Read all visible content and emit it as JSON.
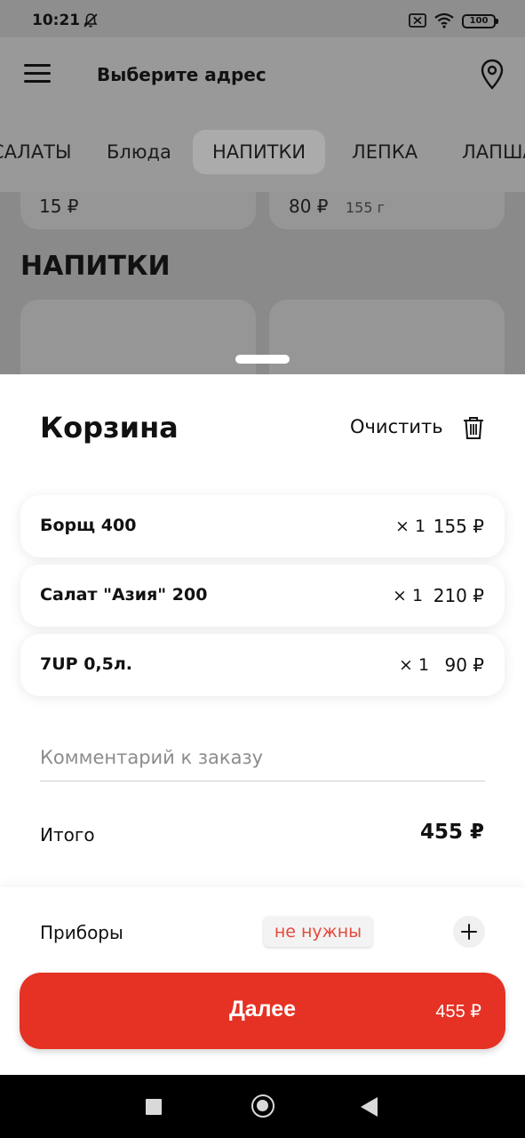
{
  "status_bar": {
    "time": "10:21",
    "battery": "100",
    "icons": [
      "dnd-off-icon",
      "sim-icon",
      "wifi-icon",
      "battery-icon"
    ]
  },
  "header": {
    "title": "Выберите адрес",
    "menu_icon": "hamburger-menu-icon",
    "location_icon": "map-pin-icon"
  },
  "tabs": [
    {
      "label": "САЛАТЫ",
      "active": false
    },
    {
      "label": "Блюда",
      "active": false
    },
    {
      "label": "НАПИТКИ",
      "active": true
    },
    {
      "label": "ЛЕПКА",
      "active": false
    },
    {
      "label": "ЛАПША",
      "active": false
    }
  ],
  "background_menu": {
    "cards": [
      {
        "price": "15 ₽"
      },
      {
        "price": "80 ₽",
        "weight": "155 г"
      }
    ],
    "section_title": "НАПИТКИ"
  },
  "cart": {
    "title": "Корзина",
    "clear_label": "Очистить",
    "items": [
      {
        "name": "Борщ 400",
        "qty": "× 1",
        "price": "155 ₽"
      },
      {
        "name": "Салат \"Азия\" 200",
        "qty": "× 1",
        "price": "210 ₽"
      },
      {
        "name": "7UP 0,5л.",
        "qty": "× 1",
        "price": "90 ₽"
      }
    ],
    "comment_placeholder": "Комментарий к заказу",
    "total_label": "Итого",
    "total_value": "455 ₽",
    "cutlery_label": "Приборы",
    "cutlery_value": "не нужны",
    "next_label": "Далее",
    "next_total": "455 ₽"
  },
  "colors": {
    "accent": "#e53224",
    "cutlery_text": "#e64a3b",
    "overlay_gray": "#999999"
  }
}
